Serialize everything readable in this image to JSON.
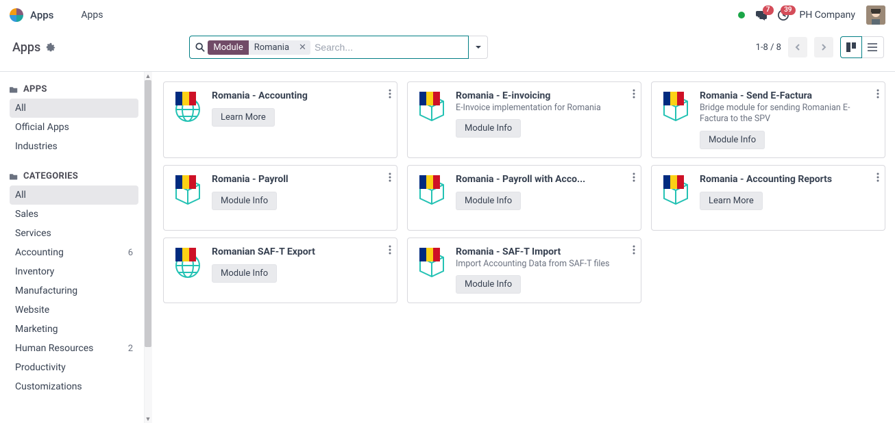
{
  "navbar": {
    "brand": "Apps",
    "menu_apps": "Apps",
    "company": "PH Company",
    "badge_messages": "7",
    "badge_activities": "39"
  },
  "panel": {
    "title": "Apps",
    "search_facet": "Module",
    "search_value": "Romania",
    "search_placeholder": "Search...",
    "pager": "1-8 / 8"
  },
  "sidebar": {
    "section_apps": "APPS",
    "section_categories": "CATEGORIES",
    "apps_items": [
      {
        "label": "All",
        "active": true
      },
      {
        "label": "Official Apps"
      },
      {
        "label": "Industries"
      }
    ],
    "cat_items": [
      {
        "label": "All",
        "active": true
      },
      {
        "label": "Sales"
      },
      {
        "label": "Services"
      },
      {
        "label": "Accounting",
        "count": "6"
      },
      {
        "label": "Inventory"
      },
      {
        "label": "Manufacturing"
      },
      {
        "label": "Website"
      },
      {
        "label": "Marketing"
      },
      {
        "label": "Human Resources",
        "count": "2"
      },
      {
        "label": "Productivity"
      },
      {
        "label": "Customizations"
      }
    ]
  },
  "buttons": {
    "learn_more": "Learn More",
    "module_info": "Module Info"
  },
  "cards": [
    {
      "title": "Romania - Accounting",
      "desc": "",
      "btn": "learn_more",
      "icon": "globe"
    },
    {
      "title": "Romania - E-invoicing",
      "desc": "E-Invoice implementation for Romania",
      "btn": "module_info",
      "icon": "cube"
    },
    {
      "title": "Romania - Send E-Factura",
      "desc": "Bridge module for sending Romanian E-Factura to the SPV",
      "btn": "module_info",
      "icon": "cube"
    },
    {
      "title": "Romania - Payroll",
      "desc": "",
      "btn": "module_info",
      "icon": "cube"
    },
    {
      "title": "Romania - Payroll with Acco...",
      "desc": "",
      "btn": "module_info",
      "icon": "cube"
    },
    {
      "title": "Romania - Accounting Reports",
      "desc": "",
      "btn": "learn_more",
      "icon": "cube"
    },
    {
      "title": "Romanian SAF-T Export",
      "desc": "",
      "btn": "module_info",
      "icon": "globe"
    },
    {
      "title": "Romania - SAF-T Import",
      "desc": "Import Accounting Data from SAF-T files",
      "btn": "module_info",
      "icon": "cube"
    }
  ]
}
